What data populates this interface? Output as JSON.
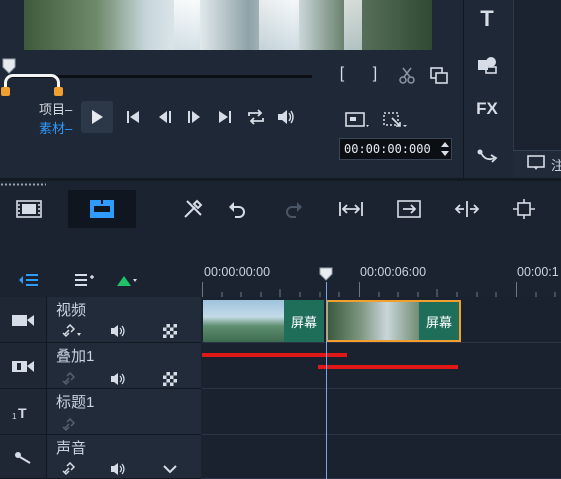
{
  "preview": {
    "mode_project": "项目",
    "mode_clip": "素材",
    "mode_project_dash": "–",
    "mode_clip_dash": "–",
    "mark_in": "[",
    "mark_out": "]",
    "timecode": "00:00:00:000"
  },
  "right_strip": {
    "title_tool": "T",
    "fx_tool": "FX",
    "panel_text": "注"
  },
  "timeline": {
    "ruler_labels": [
      "00:00:00:00",
      "00:00:06:00",
      "00:00:1"
    ],
    "tracks": [
      {
        "name": "视频",
        "icon": "video-track-icon"
      },
      {
        "name": "叠加1",
        "icon": "overlay-track-icon"
      },
      {
        "name": "标题1",
        "icon": "title-track-icon"
      },
      {
        "name": "声音",
        "icon": "voice-track-icon"
      }
    ],
    "clips": [
      {
        "label": "屏幕"
      },
      {
        "label": "屏幕"
      }
    ]
  },
  "colors": {
    "accent_blue": "#2f9bff",
    "clip_green": "#1f6e5a",
    "trim_orange": "#f0a030",
    "annotation_red": "#e01818",
    "add_green": "#1fc46a"
  }
}
